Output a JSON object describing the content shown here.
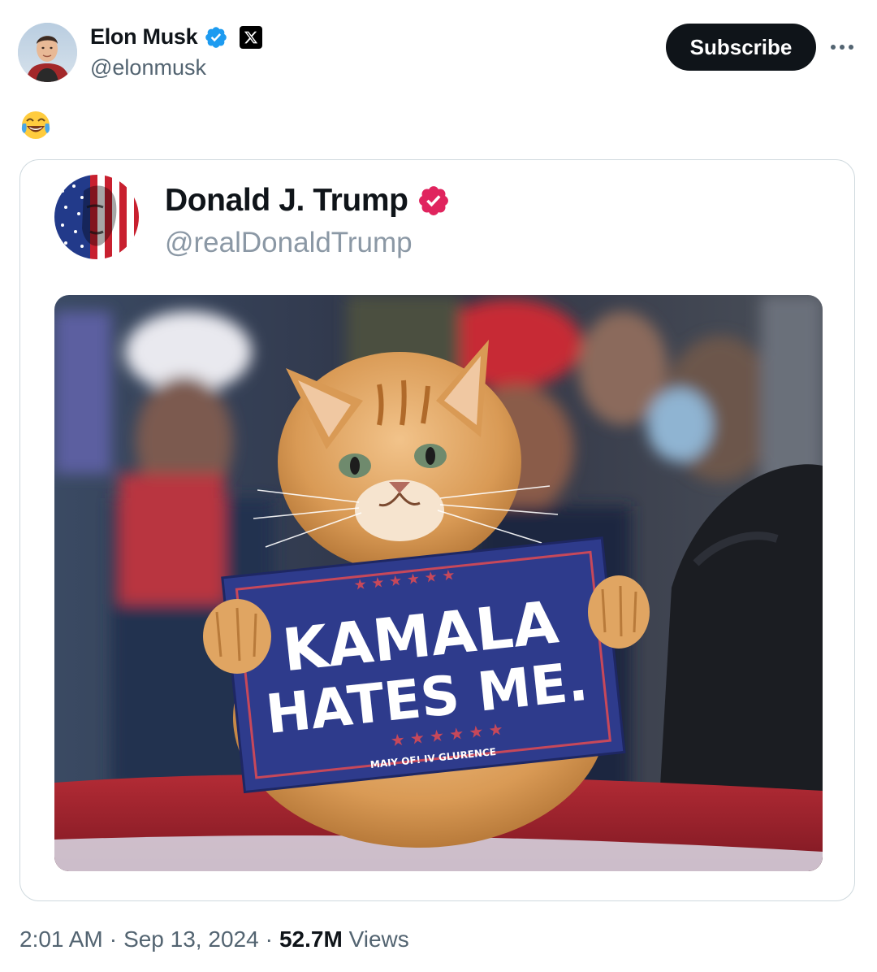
{
  "author": {
    "display_name": "Elon Musk",
    "handle": "@elonmusk",
    "verified_color": "#1d9bf0",
    "badge_icon": "x-logo-icon"
  },
  "subscribe_label": "Subscribe",
  "tweet_text_emoji": "face-with-tears-of-joy",
  "quoted": {
    "display_name": "Donald J. Trump",
    "handle": "@realDonaldTrump",
    "verified_color": "#e0245e",
    "image": {
      "sign_line1": "KAMALA",
      "sign_line2": "HATES ME.",
      "sign_small": "MAIY OF! IV GLURENCE"
    }
  },
  "footer": {
    "time": "2:01 AM",
    "date": "Sep 13, 2024",
    "views_count": "52.7M",
    "views_label": "Views"
  }
}
